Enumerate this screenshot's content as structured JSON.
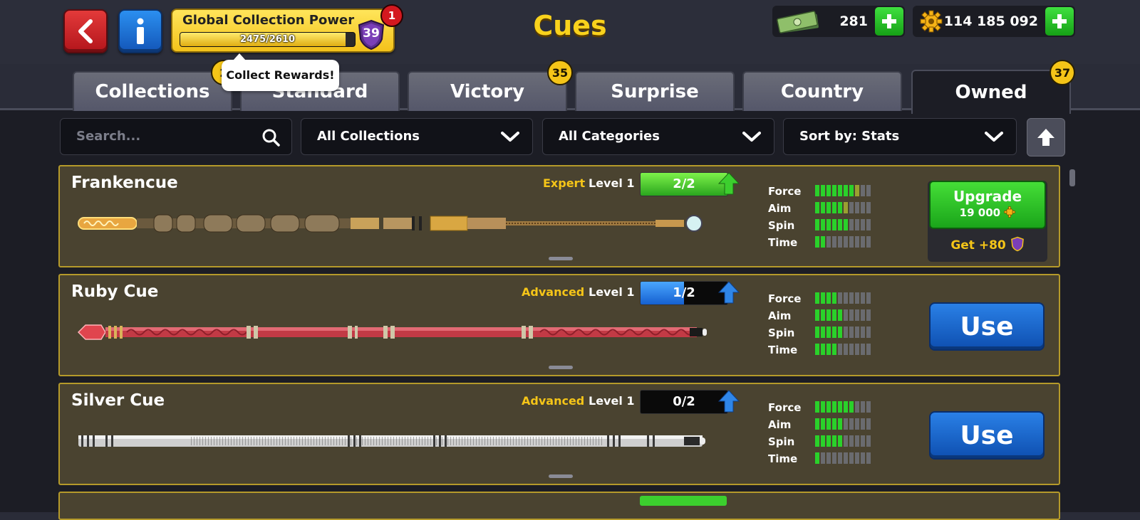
{
  "header": {
    "title": "Cues",
    "collection_power": {
      "label": "Global Collection Power",
      "progress_text": "2475/2610",
      "progress": 0.948,
      "level": "39",
      "notification_count": "1"
    },
    "cash": "281",
    "coins": "114 185 092"
  },
  "tooltip": "Collect Rewards!",
  "tabs": [
    {
      "label": "Collections",
      "badge": "2"
    },
    {
      "label": "Standard",
      "badge": ""
    },
    {
      "label": "Victory",
      "badge": "35"
    },
    {
      "label": "Surprise",
      "badge": ""
    },
    {
      "label": "Country",
      "badge": ""
    },
    {
      "label": "Owned",
      "badge": "37",
      "active": true
    }
  ],
  "filters": {
    "search_placeholder": "Search...",
    "collections": "All Collections",
    "categories": "All Categories",
    "sort": "Sort by: Stats"
  },
  "stat_labels": [
    "Force",
    "Aim",
    "Spin",
    "Time"
  ],
  "cues": [
    {
      "name": "Frankencue",
      "rank": "Expert",
      "level_label": "Level 1",
      "progress": "2/2",
      "progress_fraction": 1.0,
      "stats": {
        "force": 7.5,
        "aim": 5.5,
        "spin": 6,
        "time": 2
      },
      "action": "upgrade",
      "upgrade_label": "Upgrade",
      "upgrade_price": "19 000",
      "bonus_label": "Get +80"
    },
    {
      "name": "Ruby Cue",
      "rank": "Advanced",
      "level_label": "Level 1",
      "progress": "1/2",
      "progress_fraction": 0.5,
      "stats": {
        "force": 4,
        "aim": 5,
        "spin": 5,
        "time": 4
      },
      "action": "use",
      "use_label": "Use"
    },
    {
      "name": "Silver Cue",
      "rank": "Advanced",
      "level_label": "Level 1",
      "progress": "0/2",
      "progress_fraction": 0.0,
      "stats": {
        "force": 7,
        "aim": 5,
        "spin": 5,
        "time": 1
      },
      "action": "use",
      "use_label": "Use"
    }
  ],
  "colors": {
    "accent_yellow": "#f5c518",
    "card_bg": "#4a4330",
    "card_border": "#b59a2a",
    "stat_on": "#2ad12a",
    "use_blue": "#1a66d0",
    "upgrade_green": "#2fc22a"
  },
  "icons": [
    "back-arrow-icon",
    "info-icon",
    "shield-icon",
    "cash-icon",
    "coin-gear-icon",
    "plus-icon",
    "search-icon",
    "chevron-down-icon",
    "arrow-up-icon"
  ]
}
